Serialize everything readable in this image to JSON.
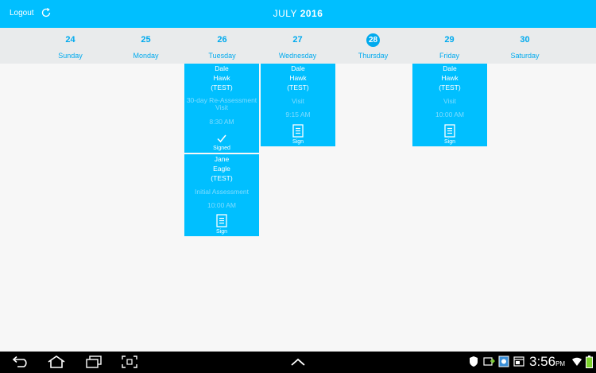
{
  "header": {
    "logout_label": "Logout",
    "month": "JULY",
    "year": "2016"
  },
  "week": [
    {
      "num": "24",
      "name": "Sunday"
    },
    {
      "num": "25",
      "name": "Monday"
    },
    {
      "num": "26",
      "name": "Tuesday"
    },
    {
      "num": "27",
      "name": "Wednesday"
    },
    {
      "num": "28",
      "name": "Thursday"
    },
    {
      "num": "29",
      "name": "Friday"
    },
    {
      "num": "30",
      "name": "Saturday"
    }
  ],
  "appointments": [
    {
      "first": "Dale",
      "last": "Hawk",
      "tag": "(TEST)",
      "type": "30-day Re-Assessment Visit",
      "time": "8:30 AM",
      "status": "Signed"
    },
    {
      "first": "Jane",
      "last": "Eagle",
      "tag": "(TEST)",
      "type": "Initial Assessment",
      "time": "10:00 AM",
      "status": "Sign"
    },
    {
      "first": "Dale",
      "last": "Hawk",
      "tag": "(TEST)",
      "type": "Visit",
      "time": "9:15 AM",
      "status": "Sign"
    },
    {
      "first": "Dale",
      "last": "Hawk",
      "tag": "(TEST)",
      "type": "Visit",
      "time": "10:00 AM",
      "status": "Sign"
    }
  ],
  "status_bar": {
    "time": "3:56",
    "ampm": "PM"
  },
  "colors": {
    "accent": "#00bfff",
    "day_text": "#00aaee",
    "week_bg": "#e9ebec"
  }
}
